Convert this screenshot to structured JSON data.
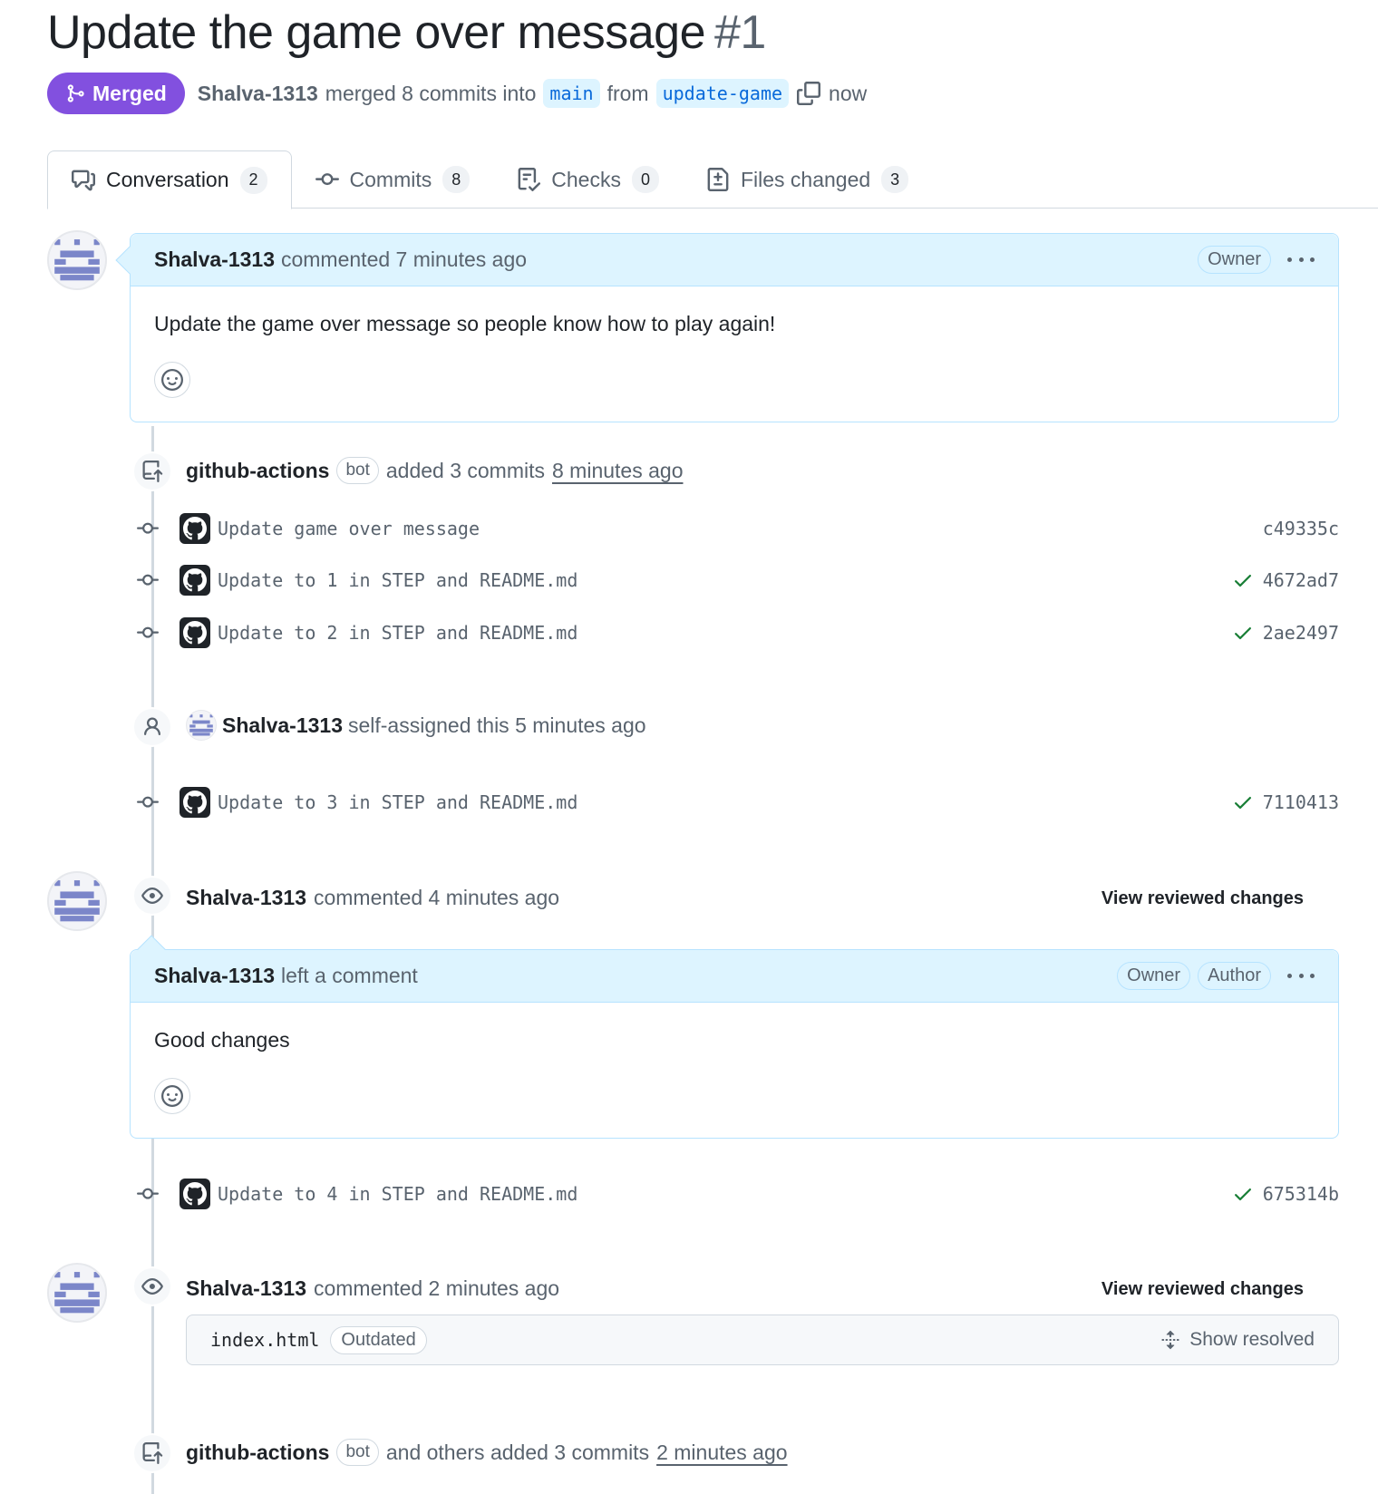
{
  "pr": {
    "title": "Update the game over message",
    "number": "#1",
    "state": "Merged",
    "author": "Shalva-1313",
    "merge_text": "merged 8 commits into",
    "base_branch": "main",
    "from_text": "from",
    "head_branch": "update-game",
    "time": "now"
  },
  "tabs": [
    {
      "label": "Conversation",
      "count": "2"
    },
    {
      "label": "Commits",
      "count": "8"
    },
    {
      "label": "Checks",
      "count": "0"
    },
    {
      "label": "Files changed",
      "count": "3"
    }
  ],
  "comment1": {
    "author": "Shalva-1313",
    "meta": "commented 7 minutes ago",
    "role": "Owner",
    "body": "Update the game over message so people know how to play again!"
  },
  "event_commits1": {
    "actor": "github-actions",
    "bot": "bot",
    "text": "added 3 commits",
    "time": "8 minutes ago"
  },
  "commits": [
    {
      "message": "Update game over message",
      "sha": "c49335c",
      "check": false
    },
    {
      "message": "Update to 1 in STEP and README.md",
      "sha": "4672ad7",
      "check": true
    },
    {
      "message": "Update to 2 in STEP and README.md",
      "sha": "2ae2497",
      "check": true
    },
    {
      "message": "Update to 3 in STEP and README.md",
      "sha": "7110413",
      "check": true
    },
    {
      "message": "Update to 4 in STEP and README.md",
      "sha": "675314b",
      "check": true
    }
  ],
  "event_assign": {
    "actor": "Shalva-1313",
    "text": "self-assigned this 5 minutes ago"
  },
  "review1": {
    "author": "Shalva-1313",
    "meta": "commented 4 minutes ago",
    "link": "View reviewed changes",
    "inner_author": "Shalva-1313",
    "inner_meta": "left a comment",
    "roles": [
      "Owner",
      "Author"
    ],
    "body": "Good changes"
  },
  "review2": {
    "author": "Shalva-1313",
    "meta": "commented 2 minutes ago",
    "link": "View reviewed changes",
    "file": "index.html",
    "tag": "Outdated",
    "show_resolved": "Show resolved"
  },
  "event_commits2": {
    "actor": "github-actions",
    "bot": "bot",
    "text": "and others added 3 commits",
    "time": "2 minutes ago"
  },
  "colors": {
    "merged": "#8250df",
    "accent_bg": "#ddf4ff",
    "link": "#0969da",
    "success": "#1a7f37",
    "avatar": "#7b86c9"
  }
}
